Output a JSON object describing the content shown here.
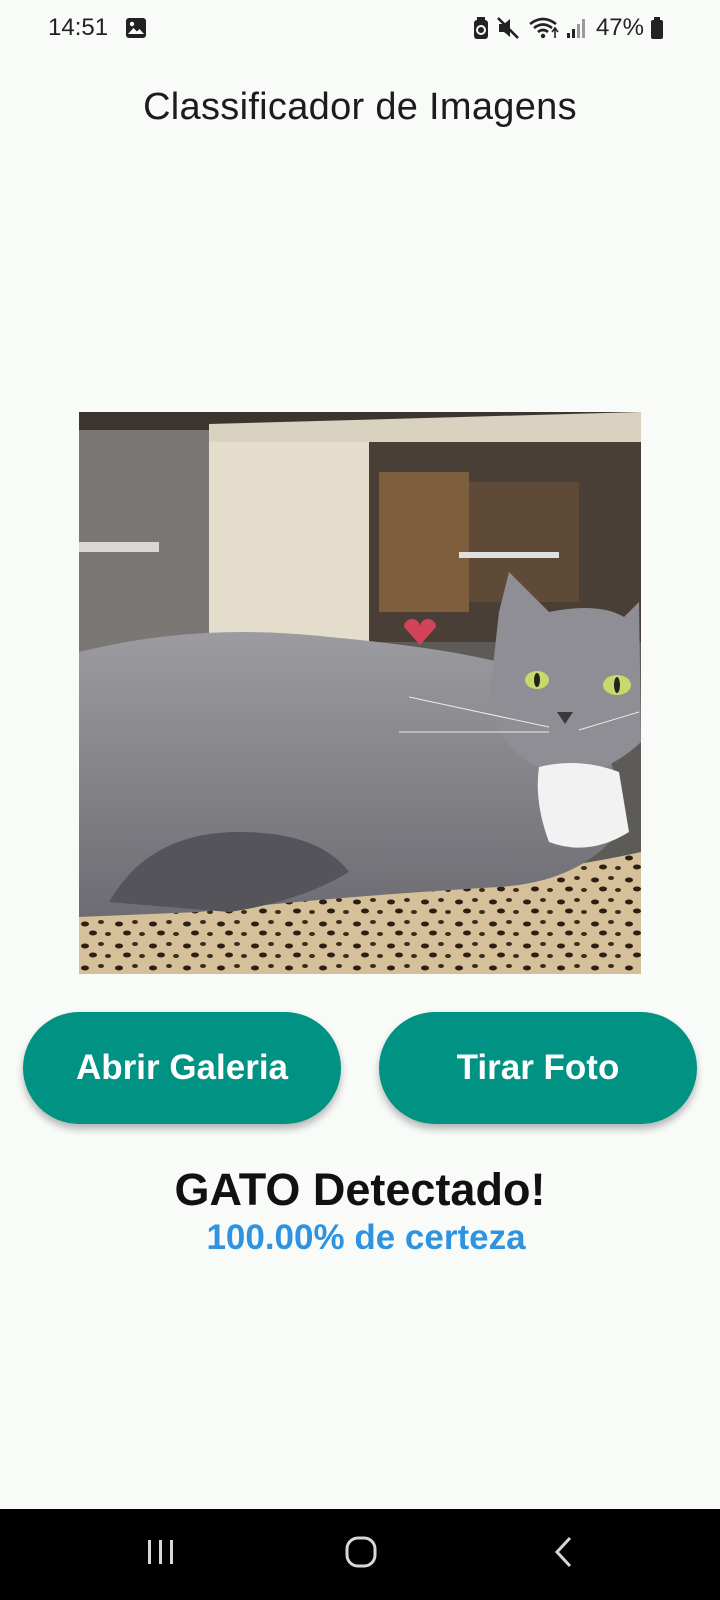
{
  "status_bar": {
    "time": "14:51",
    "battery_percent": "47%",
    "icons": [
      "image-icon",
      "battery-saver-icon",
      "mute-icon",
      "wifi-icon",
      "signal-icon",
      "battery-icon"
    ]
  },
  "app": {
    "title": "Classificador de Imagens"
  },
  "image": {
    "subject": "photo-cat"
  },
  "buttons": {
    "gallery_label": "Abrir Galeria",
    "camera_label": "Tirar Foto"
  },
  "result": {
    "title": "GATO Detectado!",
    "confidence": "100.00% de certeza"
  },
  "nav_bar": {
    "icons": [
      "recents-icon",
      "home-icon",
      "back-icon"
    ]
  },
  "colors": {
    "background": "#f9fbf9",
    "button": "#009282",
    "confidence_text": "#2f93e0",
    "nav_bar": "#000000"
  }
}
